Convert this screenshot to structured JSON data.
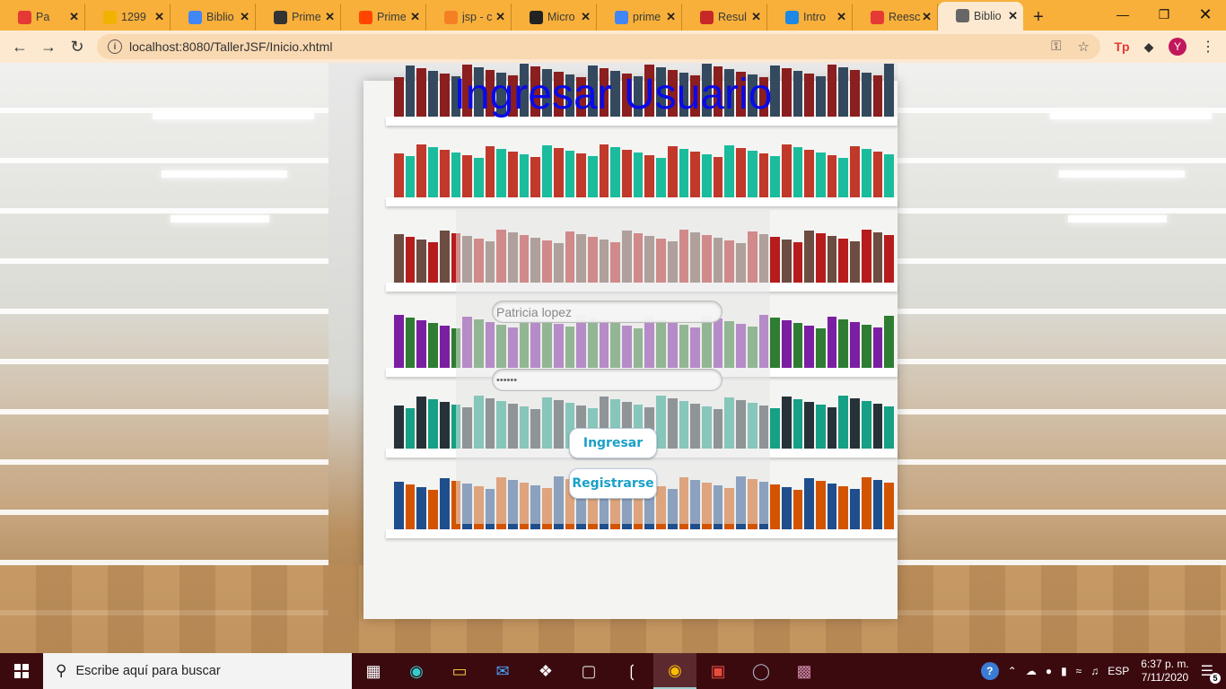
{
  "browser": {
    "tabs": [
      {
        "label": "Pa",
        "favicon_color": "#e53935",
        "favicon_glyph": "record-icon"
      },
      {
        "label": "1299",
        "favicon_color": "#f2b200",
        "favicon_glyph": "shield-icon"
      },
      {
        "label": "Biblio",
        "favicon_color": "#4285f4",
        "favicon_glyph": "docs-icon"
      },
      {
        "label": "Prime",
        "favicon_color": "#333333",
        "favicon_glyph": "prime-icon"
      },
      {
        "label": "Prime",
        "favicon_color": "#ff4500",
        "favicon_glyph": "reddit-icon"
      },
      {
        "label": "jsp - c",
        "favicon_color": "#f48024",
        "favicon_glyph": "stackoverflow-icon"
      },
      {
        "label": "Micro",
        "favicon_color": "#222222",
        "favicon_glyph": "d-icon"
      },
      {
        "label": "prime",
        "favicon_color": "#4285f4",
        "favicon_glyph": "google-icon"
      },
      {
        "label": "Resul",
        "favicon_color": "#c62828",
        "favicon_glyph": "flag-icon"
      },
      {
        "label": "Intro",
        "favicon_color": "#1e88e5",
        "favicon_glyph": "a-icon"
      },
      {
        "label": "Reesc",
        "favicon_color": "#e53935",
        "favicon_glyph": "reddit-icon"
      },
      {
        "label": "Biblio",
        "favicon_color": "#666666",
        "favicon_glyph": "page-icon"
      }
    ],
    "active_tab_index": 11,
    "url": "localhost:8080/TallerJSF/Inicio.xhtml",
    "profile_initial": "Y"
  },
  "page": {
    "title": "Ingresar Usuario",
    "username_value": "Patricia lopez",
    "password_masked": "••••••",
    "login_button": "Ingresar",
    "register_button": "Registrarse"
  },
  "taskbar": {
    "search_placeholder": "Escribe aquí para buscar",
    "language": "ESP",
    "time": "6:37 p. m.",
    "date": "7/11/2020",
    "notifications_count": "5"
  },
  "colors": {
    "tabbar": "#f8b03a",
    "toolbar": "#fde9d0",
    "title": "#0a0ae6",
    "button_text": "#1aa0c8",
    "taskbar": "#3b0a0f"
  }
}
